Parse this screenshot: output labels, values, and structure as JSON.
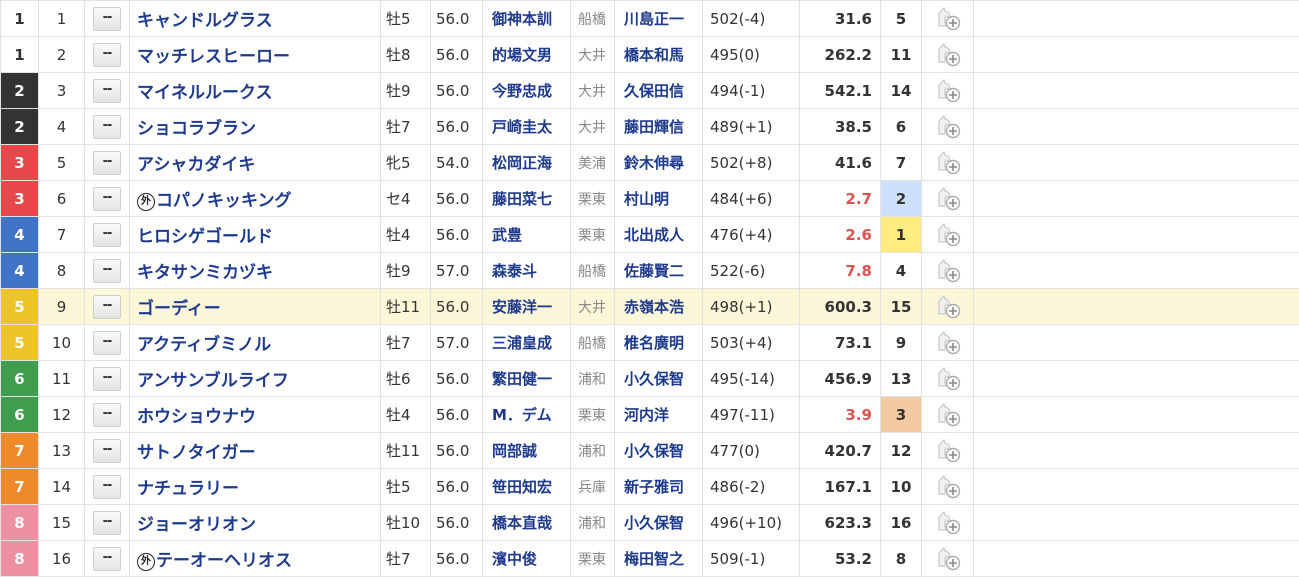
{
  "waku_colors": {
    "1": {
      "bg": "#ffffff",
      "fg": "#333333"
    },
    "2": {
      "bg": "#333333",
      "fg": "#ffffff"
    },
    "3": {
      "bg": "#e6474b",
      "fg": "#ffffff"
    },
    "4": {
      "bg": "#3f74c9",
      "fg": "#ffffff"
    },
    "5": {
      "bg": "#ecc42a",
      "fg": "#ffffff"
    },
    "6": {
      "bg": "#3f9e4d",
      "fg": "#ffffff"
    },
    "7": {
      "bg": "#ef8a2c",
      "fg": "#ffffff"
    },
    "8": {
      "bg": "#ef8fa2",
      "fg": "#ffffff"
    }
  },
  "mark_label": "--",
  "foreign_mark": "外",
  "icons": {
    "mark_button": "mark-select-button",
    "favorite": "horse-add-favorite-icon"
  },
  "entries": [
    {
      "waku": "1",
      "umaban": "1",
      "horse": "キャンドルグラス",
      "foreign": false,
      "sex_age": "牡5",
      "weight": "56.0",
      "jockey": "御神本訓",
      "affil": "船橋",
      "trainer": "川島正一",
      "body_weight": "502(-4)",
      "odds": "31.6",
      "odds_fav": false,
      "pop": "5"
    },
    {
      "waku": "1",
      "umaban": "2",
      "horse": "マッチレスヒーロー",
      "foreign": false,
      "sex_age": "牡8",
      "weight": "56.0",
      "jockey": "的場文男",
      "affil": "大井",
      "trainer": "橋本和馬",
      "body_weight": "495(0)",
      "odds": "262.2",
      "odds_fav": false,
      "pop": "11"
    },
    {
      "waku": "2",
      "umaban": "3",
      "horse": "マイネルルークス",
      "foreign": false,
      "sex_age": "牡9",
      "weight": "56.0",
      "jockey": "今野忠成",
      "affil": "大井",
      "trainer": "久保田信",
      "body_weight": "494(-1)",
      "odds": "542.1",
      "odds_fav": false,
      "pop": "14"
    },
    {
      "waku": "2",
      "umaban": "4",
      "horse": "ショコラブラン",
      "foreign": false,
      "sex_age": "牡7",
      "weight": "56.0",
      "jockey": "戸崎圭太",
      "affil": "大井",
      "trainer": "藤田輝信",
      "body_weight": "489(+1)",
      "odds": "38.5",
      "odds_fav": false,
      "pop": "6"
    },
    {
      "waku": "3",
      "umaban": "5",
      "horse": "アシャカダイキ",
      "foreign": false,
      "sex_age": "牝5",
      "weight": "54.0",
      "jockey": "松岡正海",
      "affil": "美浦",
      "trainer": "鈴木伸尋",
      "body_weight": "502(+8)",
      "odds": "41.6",
      "odds_fav": false,
      "pop": "7"
    },
    {
      "waku": "3",
      "umaban": "6",
      "horse": "コパノキッキング",
      "foreign": true,
      "sex_age": "セ4",
      "weight": "56.0",
      "jockey": "藤田菜七",
      "affil": "栗東",
      "trainer": "村山明",
      "body_weight": "484(+6)",
      "odds": "2.7",
      "odds_fav": true,
      "pop": "2"
    },
    {
      "waku": "4",
      "umaban": "7",
      "horse": "ヒロシゲゴールド",
      "foreign": false,
      "sex_age": "牡4",
      "weight": "56.0",
      "jockey": "武豊",
      "affil": "栗東",
      "trainer": "北出成人",
      "body_weight": "476(+4)",
      "odds": "2.6",
      "odds_fav": true,
      "pop": "1"
    },
    {
      "waku": "4",
      "umaban": "8",
      "horse": "キタサンミカヅキ",
      "foreign": false,
      "sex_age": "牡9",
      "weight": "57.0",
      "jockey": "森泰斗",
      "affil": "船橋",
      "trainer": "佐藤賢二",
      "body_weight": "522(-6)",
      "odds": "7.8",
      "odds_fav": true,
      "pop": "4"
    },
    {
      "waku": "5",
      "umaban": "9",
      "horse": "ゴーディー",
      "foreign": false,
      "sex_age": "牡11",
      "weight": "56.0",
      "jockey": "安藤洋一",
      "affil": "大井",
      "trainer": "赤嶺本浩",
      "body_weight": "498(+1)",
      "odds": "600.3",
      "odds_fav": false,
      "pop": "15",
      "highlight": true
    },
    {
      "waku": "5",
      "umaban": "10",
      "horse": "アクティブミノル",
      "foreign": false,
      "sex_age": "牡7",
      "weight": "57.0",
      "jockey": "三浦皇成",
      "affil": "船橋",
      "trainer": "椎名廣明",
      "body_weight": "503(+4)",
      "odds": "73.1",
      "odds_fav": false,
      "pop": "9"
    },
    {
      "waku": "6",
      "umaban": "11",
      "horse": "アンサンブルライフ",
      "foreign": false,
      "sex_age": "牡6",
      "weight": "56.0",
      "jockey": "繁田健一",
      "affil": "浦和",
      "trainer": "小久保智",
      "body_weight": "495(-14)",
      "odds": "456.9",
      "odds_fav": false,
      "pop": "13"
    },
    {
      "waku": "6",
      "umaban": "12",
      "horse": "ホウショウナウ",
      "foreign": false,
      "sex_age": "牡4",
      "weight": "56.0",
      "jockey": "M．デム",
      "affil": "栗東",
      "trainer": "河内洋",
      "body_weight": "497(-11)",
      "odds": "3.9",
      "odds_fav": true,
      "pop": "3"
    },
    {
      "waku": "7",
      "umaban": "13",
      "horse": "サトノタイガー",
      "foreign": false,
      "sex_age": "牡11",
      "weight": "56.0",
      "jockey": "岡部誠",
      "affil": "浦和",
      "trainer": "小久保智",
      "body_weight": "477(0)",
      "odds": "420.7",
      "odds_fav": false,
      "pop": "12"
    },
    {
      "waku": "7",
      "umaban": "14",
      "horse": "ナチュラリー",
      "foreign": false,
      "sex_age": "牡5",
      "weight": "56.0",
      "jockey": "笹田知宏",
      "affil": "兵庫",
      "trainer": "新子雅司",
      "body_weight": "486(-2)",
      "odds": "167.1",
      "odds_fav": false,
      "pop": "10"
    },
    {
      "waku": "8",
      "umaban": "15",
      "horse": "ジョーオリオン",
      "foreign": false,
      "sex_age": "牡10",
      "weight": "56.0",
      "jockey": "橋本直哉",
      "affil": "浦和",
      "trainer": "小久保智",
      "body_weight": "496(+10)",
      "odds": "623.3",
      "odds_fav": false,
      "pop": "16"
    },
    {
      "waku": "8",
      "umaban": "16",
      "horse": "テーオーヘリオス",
      "foreign": true,
      "sex_age": "牡7",
      "weight": "56.0",
      "jockey": "濱中俊",
      "affil": "栗東",
      "trainer": "梅田智之",
      "body_weight": "509(-1)",
      "odds": "53.2",
      "odds_fav": false,
      "pop": "8"
    }
  ]
}
